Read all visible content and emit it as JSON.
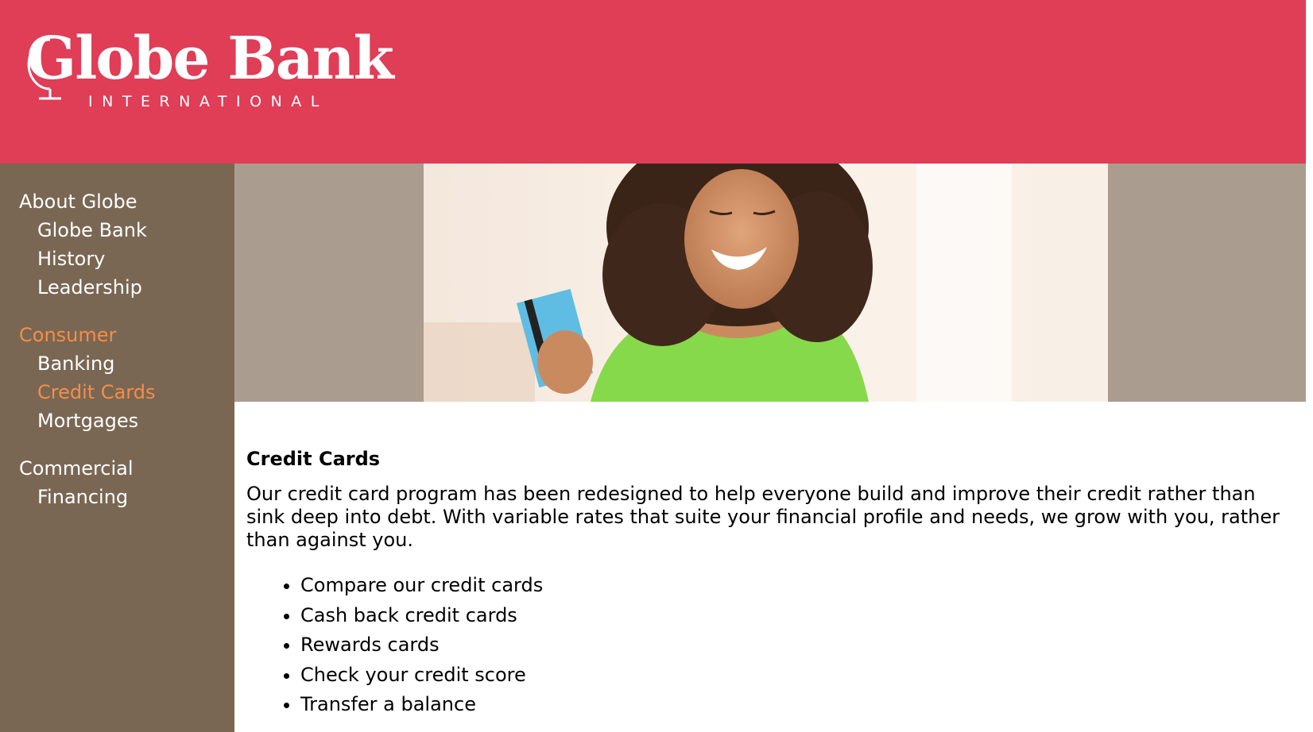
{
  "brand": {
    "name": "Globe Bank",
    "tagline": "INTERNATIONAL",
    "color": "#e03d56"
  },
  "sidebar": {
    "groups": [
      {
        "heading": "About Globe",
        "items": [
          "Globe Bank",
          "History",
          "Leadership"
        ]
      },
      {
        "heading": "Consumer",
        "items": [
          "Banking",
          "Credit Cards",
          "Mortgages"
        ]
      },
      {
        "heading": "Commercial",
        "items": [
          "Financing"
        ]
      }
    ],
    "active_color": "#f58d48",
    "background": "#7a6753"
  },
  "hero": {
    "alt": "Woman holding a blue credit card"
  },
  "content": {
    "title": "Credit Cards",
    "body": "Our credit card program has been redesigned to help everyone build and improve their credit rather than sink deep into debt. With variable rates that suite your financial profile and needs, we grow with you, rather than against you.",
    "links": [
      "Compare our credit cards",
      "Cash back credit cards",
      "Rewards cards",
      "Check your credit score",
      "Transfer a balance"
    ]
  }
}
